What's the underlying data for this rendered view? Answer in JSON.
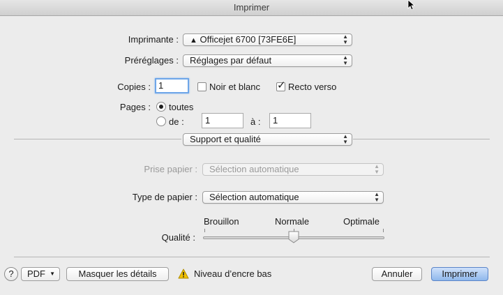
{
  "window": {
    "title": "Imprimer"
  },
  "printer": {
    "label": "Imprimante :",
    "value": "Officejet 6700 [73FE6E]",
    "icon": "warning-triangle-icon"
  },
  "presets": {
    "label": "Préréglages :",
    "value": "Réglages par défaut"
  },
  "copies": {
    "label": "Copies :",
    "value": "1",
    "black_white": {
      "label": "Noir et blanc",
      "checked": false
    },
    "duplex": {
      "label": "Recto verso",
      "checked": true
    }
  },
  "pages": {
    "label": "Pages :",
    "all_label": "toutes",
    "all_selected": true,
    "range_label": "de :",
    "range_selected": false,
    "from": "1",
    "to_label": "à :",
    "to": "1"
  },
  "section": {
    "value": "Support et qualité"
  },
  "paper_feed": {
    "label": "Prise papier :",
    "value": "Sélection automatique",
    "enabled": false
  },
  "paper_type": {
    "label": "Type de papier :",
    "value": "Sélection automatique"
  },
  "quality": {
    "label": "Qualité :",
    "levels": [
      "Brouillon",
      "Normale",
      "Optimale"
    ],
    "selected": "Normale"
  },
  "footer": {
    "help_label": "?",
    "pdf_label": "PDF",
    "hide_details_label": "Masquer les détails",
    "warning_text": "Niveau d’encre bas",
    "cancel_label": "Annuler",
    "print_label": "Imprimer"
  },
  "colors": {
    "default_button": "#8fb8ec",
    "focus_ring": "#6ea6e8",
    "warning": "#f2c200"
  }
}
